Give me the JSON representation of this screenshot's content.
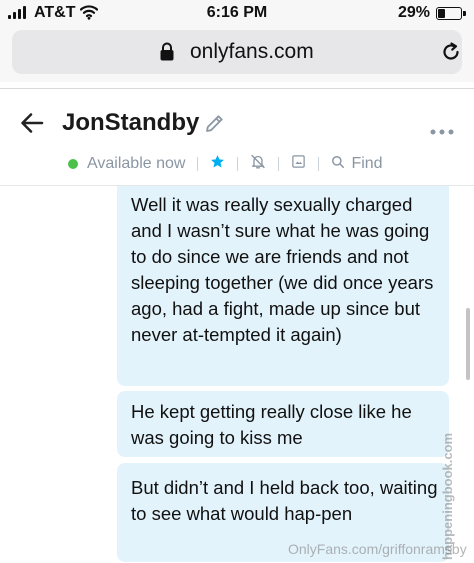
{
  "status_bar": {
    "carrier": "AT&T",
    "time": "6:16 PM",
    "battery_percent": "29%",
    "battery_level": 0.29
  },
  "browser": {
    "url": "onlyfans.com"
  },
  "chat": {
    "title": "JonStandby",
    "status": "Available now",
    "find_label": "Find"
  },
  "messages": [
    {
      "text": "Well it was really sexually charged and I wasn’t sure what he was going to do since we are friends and not sleeping together (we did once years ago, had a fight, made up since but never at-tempted it again)"
    },
    {
      "text": "He kept getting really close like he was going to kiss me"
    },
    {
      "text": "But didn’t and I held back too, waiting to see what would hap-pen"
    }
  ],
  "watermarks": {
    "bottom": "OnlyFans.com/griffonramsby",
    "side": "happeningbook.com"
  },
  "colors": {
    "bubble": "#e3f3fb",
    "accent": "#00aff0",
    "status_online": "#4cc14a",
    "muted": "#8a96a3"
  },
  "icons": [
    "signal-icon",
    "wifi-icon",
    "battery-icon",
    "lock-icon",
    "reload-icon",
    "back-arrow-icon",
    "edit-icon",
    "more-icon",
    "star-icon",
    "bell-off-icon",
    "image-icon",
    "search-icon"
  ]
}
